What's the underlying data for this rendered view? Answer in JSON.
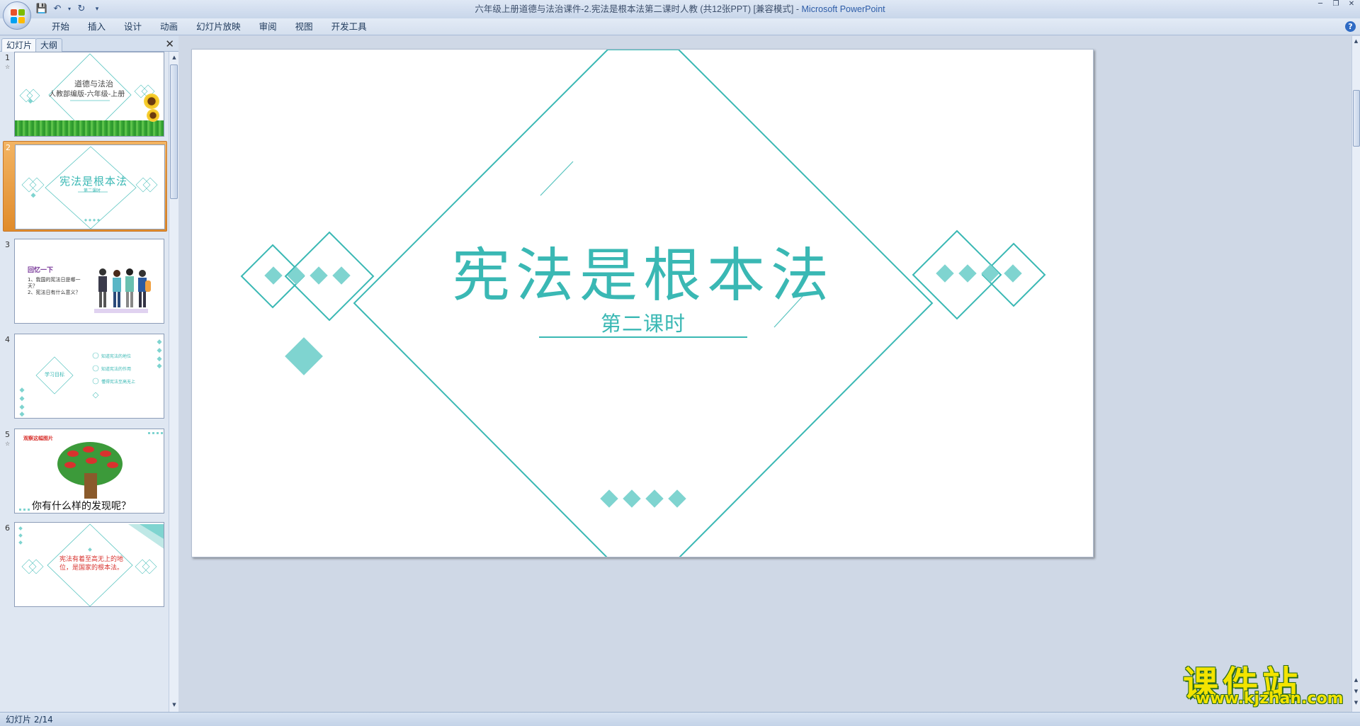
{
  "window": {
    "title": "六年级上册道德与法治课件-2.宪法是根本法第二课时人教 (共12张PPT) [兼容模式]",
    "separator": " - ",
    "app_name": "Microsoft PowerPoint"
  },
  "ribbon": {
    "tabs": [
      "开始",
      "插入",
      "设计",
      "动画",
      "幻灯片放映",
      "审阅",
      "视图",
      "开发工具"
    ]
  },
  "left_pane": {
    "tab_slides": "幻灯片",
    "tab_outline": "大纲",
    "thumbnails": [
      {
        "num": "1",
        "title_line1": "道德与法治",
        "title_line2": "人教部编版-六年级-上册"
      },
      {
        "num": "2",
        "title": "宪法是根本法",
        "subtitle": "第二课时"
      },
      {
        "num": "3",
        "heading": "回忆一下",
        "line1": "1、我国的宪法日是哪一",
        "line1b": "天？",
        "line2": "2、宪法日有什么意义？"
      },
      {
        "num": "4",
        "center": "学习目标",
        "items": [
          "知道宪法的地位",
          "知道宪法的作用",
          "懂得宪法至高无上"
        ]
      },
      {
        "num": "5",
        "heading": "观察这幅图片",
        "question": "你有什么样的发现呢？"
      },
      {
        "num": "6",
        "text": "宪法有着至高无上的地位，是国家的根本法。"
      }
    ]
  },
  "slide": {
    "title": "宪法是根本法",
    "subtitle": "第二课时",
    "accent_color": "#3ab8b4",
    "diamond_fill": "#7fd4d0"
  },
  "status": {
    "slide_counter": "幻灯片 2/14"
  },
  "watermark": {
    "text": "课件站",
    "url": "www.kjzhan.com"
  }
}
